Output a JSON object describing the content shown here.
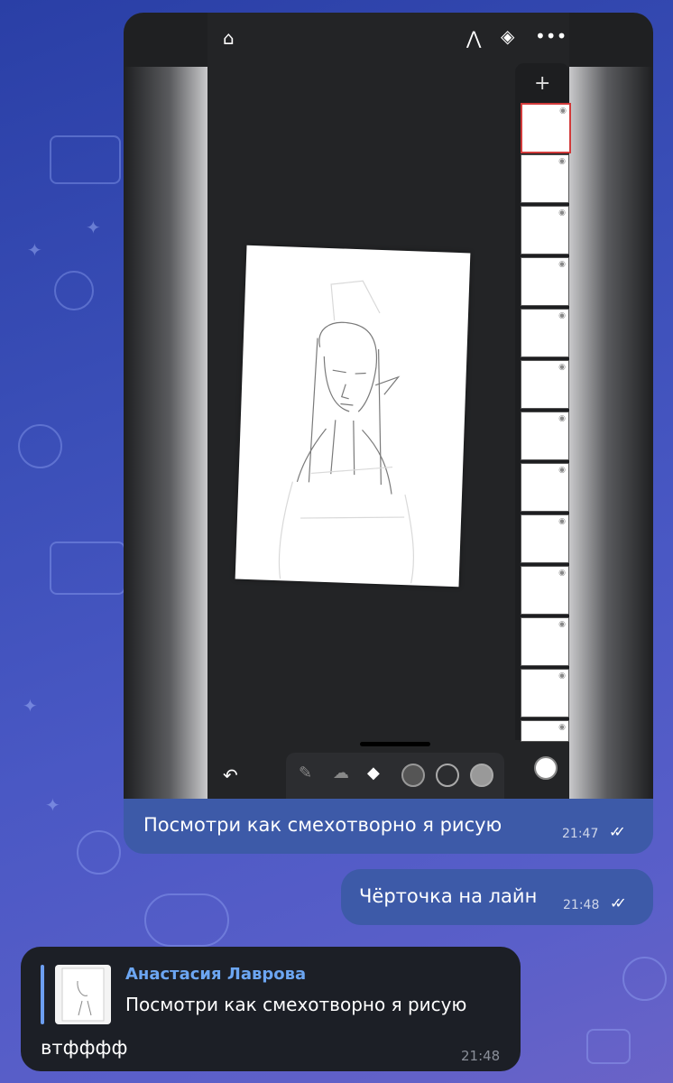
{
  "wallpaper": {
    "icons": [
      "heart-icon",
      "laptop-icon",
      "star-icon",
      "camera-icon",
      "cat-icon",
      "chat-icon"
    ]
  },
  "message_image": {
    "app_screenshot": {
      "top_icons": [
        "home-icon",
        "ruler-icon",
        "layers-icon",
        "more-icon"
      ],
      "layer_count": 13,
      "active_layer_index": 0,
      "tools": [
        "brush-icon",
        "smudge-icon",
        "eraser-icon",
        "brush-size-icon",
        "opacity-ring-icon",
        "color-swatch-icon"
      ],
      "current_color": "#ffffff"
    },
    "caption": "Посмотри как смехотворно я рисую",
    "time": "21:47",
    "status": "read"
  },
  "message_text": {
    "text": "Чёрточка на лайн",
    "time": "21:48",
    "status": "read"
  },
  "message_reply": {
    "author": "Анастасия Лаврова",
    "quoted_text": "Посмотри как смехотворно я рисую",
    "text": "втфффф",
    "time": "21:48"
  },
  "colors": {
    "outgoing_bubble": "#3d5aa8",
    "incoming_bubble": "#1c1f26",
    "reply_accent": "#6ca6f2"
  }
}
